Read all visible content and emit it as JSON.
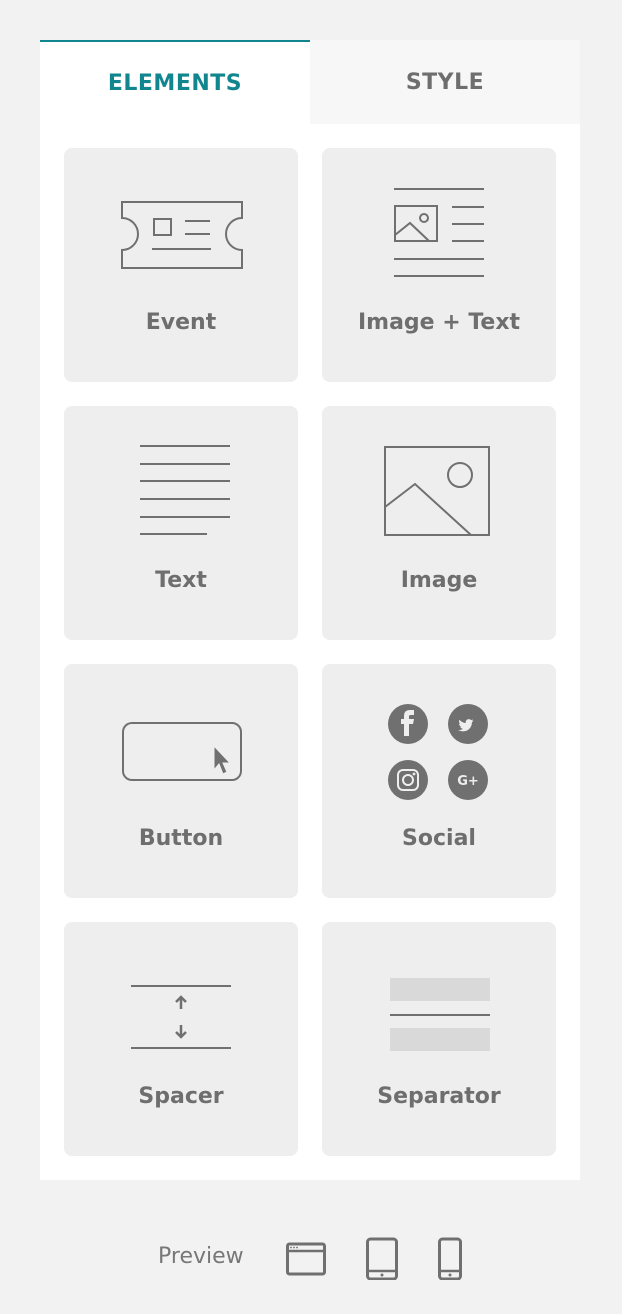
{
  "tabs": {
    "elements": "ELEMENTS",
    "style": "STYLE"
  },
  "elements": [
    {
      "label": "Event",
      "icon": "ticket-icon"
    },
    {
      "label": "Image + Text",
      "icon": "image-text-icon"
    },
    {
      "label": "Text",
      "icon": "text-lines-icon"
    },
    {
      "label": "Image",
      "icon": "image-icon"
    },
    {
      "label": "Button",
      "icon": "button-cursor-icon"
    },
    {
      "label": "Social",
      "icon": "social-icons"
    },
    {
      "label": "Spacer",
      "icon": "spacer-icon"
    },
    {
      "label": "Separator",
      "icon": "separator-icon"
    }
  ],
  "preview": {
    "label": "Preview",
    "devices": [
      "desktop-icon",
      "tablet-icon",
      "mobile-icon"
    ]
  },
  "colors": {
    "accent": "#12868f",
    "icon_stroke": "#707070",
    "tile_bg": "#eeeeee",
    "page_bg": "#f2f2f2"
  }
}
